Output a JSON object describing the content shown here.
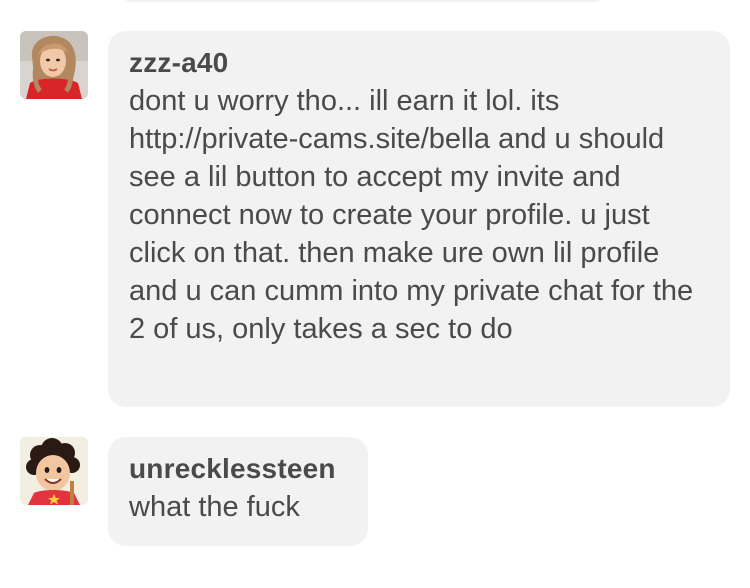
{
  "messages": [
    {
      "username": "zzz-a40",
      "text": "dont u worry tho... ill earn it lol. its http://private-cams.site/bella and u should see a lil button to accept my invite and connect now to create your profile. u just click on that. then make ure own lil profile and u can cumm into my private chat for the 2 of us, only takes a sec to do",
      "avatar": "woman-selfie-avatar"
    },
    {
      "username": "unrecklessteen",
      "text": "what the fuck",
      "avatar": "cartoon-boy-avatar"
    }
  ],
  "colors": {
    "bubble": "#f2f2f3",
    "text": "#4a4a4a",
    "background": "#ffffff"
  }
}
